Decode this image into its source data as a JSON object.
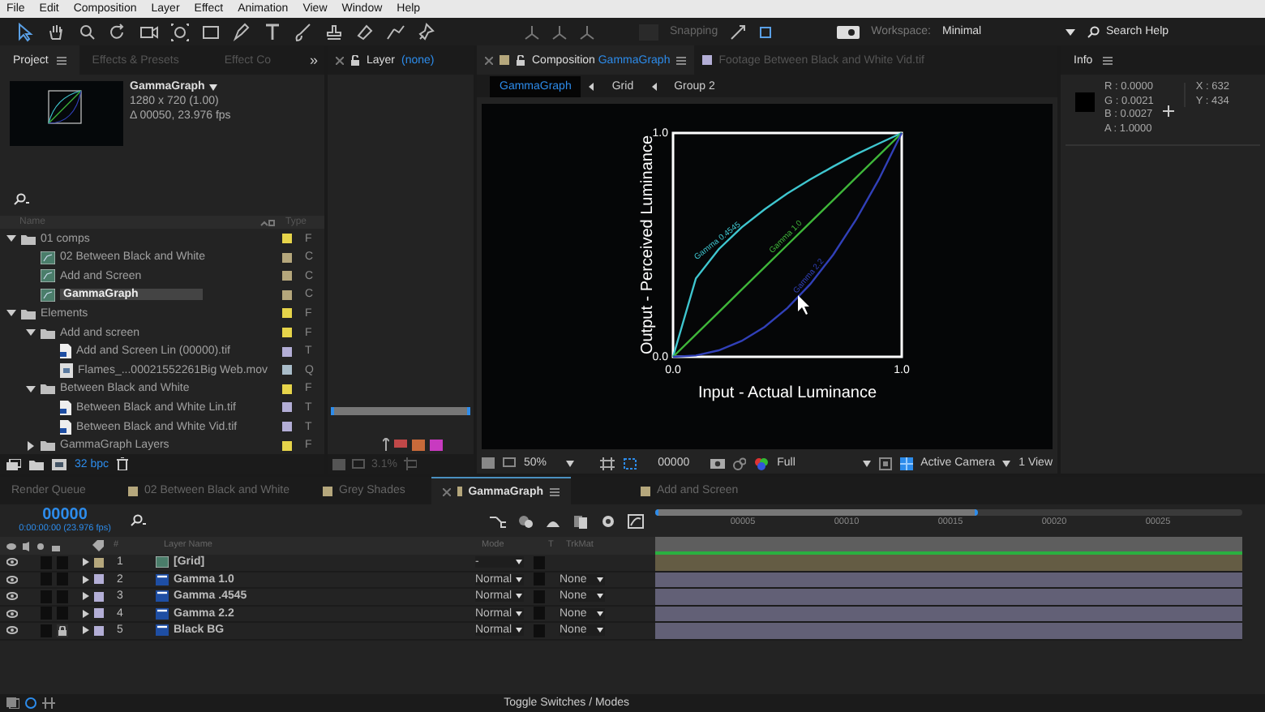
{
  "menu": [
    "File",
    "Edit",
    "Composition",
    "Layer",
    "Effect",
    "Animation",
    "View",
    "Window",
    "Help"
  ],
  "toolbar": {
    "snapping_label": "Snapping",
    "snapping_checked": false,
    "workspace_label": "Workspace:",
    "workspace_value": "Minimal",
    "search_placeholder": "Search Help"
  },
  "project_panel": {
    "tabs": [
      {
        "label": "Project",
        "selected": true
      },
      {
        "label": "Effects & Presets",
        "selected": false
      },
      {
        "label": "Effect Co",
        "selected": false
      }
    ],
    "overflow": "»",
    "preview": {
      "name": "GammaGraph",
      "size": "1280 x 720 (1.00)",
      "duration": "Δ 00050, 23.976 fps"
    },
    "columns": [
      "Name",
      "Type"
    ],
    "items": [
      {
        "kind": "folder",
        "name": "01 comps",
        "type": "F",
        "color": "#e6d44a",
        "expanded": true,
        "selected": false,
        "children": [
          {
            "kind": "comp",
            "name": "02 Between Black and White",
            "type": "C",
            "color": "#b5a77c",
            "selected": false
          },
          {
            "kind": "comp",
            "name": "Add and Screen",
            "type": "C",
            "color": "#b5a77c",
            "selected": false
          },
          {
            "kind": "comp",
            "name": "GammaGraph",
            "type": "C",
            "color": "#b5a77c",
            "selected": true
          }
        ]
      },
      {
        "kind": "folder",
        "name": "Elements",
        "type": "F",
        "color": "#e6d44a",
        "expanded": true,
        "selected": false,
        "children": [
          {
            "kind": "folder",
            "name": "Add and screen",
            "type": "F",
            "color": "#e6d44a",
            "expanded": true,
            "selected": false,
            "children": [
              {
                "kind": "image",
                "name": "Add and Screen Lin (00000).tif",
                "type": "T",
                "color": "#b3aed6",
                "selected": false
              },
              {
                "kind": "movie",
                "name": "Flames_...00021552261Big Web.mov",
                "type": "Q",
                "color": "#a9bcc9",
                "selected": false
              }
            ]
          },
          {
            "kind": "folder",
            "name": "Between Black and White",
            "type": "F",
            "color": "#e6d44a",
            "expanded": true,
            "selected": false,
            "children": [
              {
                "kind": "image",
                "name": "Between Black and White Lin.tif",
                "type": "T",
                "color": "#b3aed6",
                "selected": false
              },
              {
                "kind": "image",
                "name": "Between Black and White Vid.tif",
                "type": "T",
                "color": "#b3aed6",
                "selected": false
              }
            ]
          },
          {
            "kind": "folder",
            "name": "GammaGraph Layers",
            "type": "F",
            "color": "#e6d44a",
            "expanded": false,
            "selected": false
          }
        ]
      }
    ],
    "bit_depth": "32 bpc"
  },
  "layer_panel": {
    "tab": "Layer",
    "value": "(none)",
    "zoom": "3.1%"
  },
  "comp_panel": {
    "tabs": [
      {
        "label": "Composition",
        "name": "GammaGraph",
        "selected": true
      },
      {
        "label": "Footage",
        "name": "Between Black and White Vid.tif",
        "selected": false
      }
    ],
    "breadcrumbs": [
      {
        "label": "GammaGraph",
        "selected": true
      },
      {
        "label": "Grid",
        "selected": false
      },
      {
        "label": "Group 2",
        "selected": false
      }
    ],
    "chart_data": {
      "type": "line",
      "xlabel": "Input - Actual Luminance",
      "ylabel": "Output  - Perceived Luminance",
      "x": [
        0,
        0.1,
        0.2,
        0.3,
        0.4,
        0.5,
        0.6,
        0.7,
        0.8,
        0.9,
        1
      ],
      "series": [
        {
          "name": "Gamma 0.4545",
          "color": "#3fc6cf",
          "values": [
            0,
            0.351,
            0.481,
            0.578,
            0.659,
            0.73,
            0.793,
            0.85,
            0.904,
            0.953,
            1
          ]
        },
        {
          "name": "Gamma 1.0",
          "color": "#3fb63a",
          "values": [
            0,
            0.1,
            0.2,
            0.3,
            0.4,
            0.5,
            0.6,
            0.7,
            0.8,
            0.9,
            1
          ]
        },
        {
          "name": "Gamma 2.2",
          "color": "#3140b8",
          "values": [
            0,
            0.006,
            0.029,
            0.071,
            0.133,
            0.218,
            0.325,
            0.456,
            0.612,
            0.793,
            1
          ]
        }
      ],
      "xlim": [
        0,
        1
      ],
      "ylim": [
        0,
        1
      ],
      "xticks": [
        {
          "value": 0,
          "label": "0.0"
        },
        {
          "value": 1,
          "label": "1.0"
        }
      ],
      "yticks": [
        {
          "value": 0,
          "label": "0.0"
        },
        {
          "value": 1,
          "label": "1.0"
        }
      ]
    },
    "footer": {
      "zoom": "50%",
      "timecode": "00000",
      "resolution": "Full",
      "camera": "Active Camera",
      "views": "1 View"
    }
  },
  "info_panel": {
    "title": "Info",
    "values": [
      "R : 0.0000",
      "G : 0.0021",
      "B : 0.0027",
      "A : 1.0000"
    ],
    "coords": [
      "X : 632",
      "Y : 434"
    ]
  },
  "timeline": {
    "tabs": [
      {
        "label": "Render Queue",
        "selected": false
      },
      {
        "label": "02 Between Black and White",
        "color": "#b5a77c",
        "selected": false
      },
      {
        "label": "Grey Shades",
        "color": "#b5a77c",
        "selected": false
      },
      {
        "label": "GammaGraph",
        "color": "#b5a77c",
        "selected": true
      },
      {
        "label": "Add and Screen",
        "color": "#b5a77c",
        "selected": false
      }
    ],
    "timecode": "00000",
    "fps": "0:00:00:00 (23.976 fps)",
    "columns": [
      "#",
      "Layer Name",
      "Mode",
      "T",
      "TrkMat"
    ],
    "ruler": [
      "00005",
      "00010",
      "00015",
      "00020",
      "00025"
    ],
    "layers": [
      {
        "number": "1",
        "kind": "grid",
        "name": "[Grid]",
        "mode": "-",
        "color": "#b5a77c",
        "locked": false
      },
      {
        "number": "2",
        "kind": "shape",
        "name": "Gamma 1.0",
        "mode": "Normal",
        "trkmat": "None",
        "color": "#b3aed6",
        "locked": false
      },
      {
        "number": "3",
        "kind": "shape",
        "name": "Gamma .4545",
        "mode": "Normal",
        "trkmat": "None",
        "color": "#b3aed6",
        "locked": false
      },
      {
        "number": "4",
        "kind": "shape",
        "name": "Gamma 2.2",
        "mode": "Normal",
        "trkmat": "None",
        "color": "#b3aed6",
        "locked": false
      },
      {
        "number": "5",
        "kind": "shape",
        "name": "Black BG",
        "mode": "Normal",
        "trkmat": "None",
        "color": "#b3aed6",
        "locked": true
      }
    ],
    "toggle": "Toggle Switches / Modes"
  }
}
